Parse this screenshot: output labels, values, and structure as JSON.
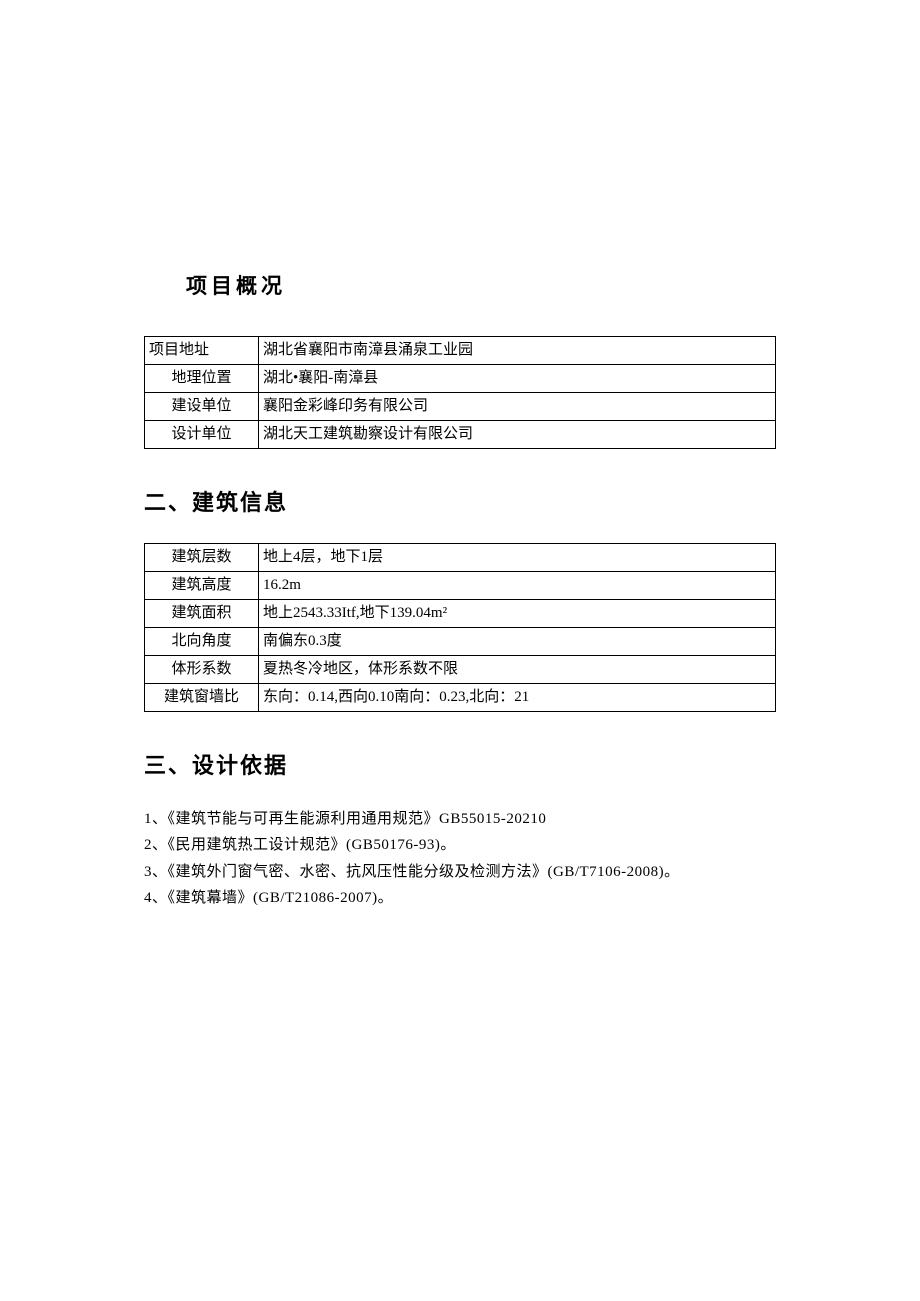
{
  "section1": {
    "title": "项目概况",
    "rows": [
      {
        "label": "项目地址",
        "value": "湖北省襄阳市南漳县涌泉工业园",
        "leftAlign": true
      },
      {
        "label": "地理位置",
        "value": "湖北•襄阳-南漳县",
        "leftAlign": false
      },
      {
        "label": "建设单位",
        "value": "襄阳金彩峰印务有限公司",
        "leftAlign": false
      },
      {
        "label": "设计单位",
        "value": "湖北天工建筑勘察设计有限公司",
        "leftAlign": false
      }
    ]
  },
  "section2": {
    "title": "二、建筑信息",
    "rows": [
      {
        "label": "建筑层数",
        "value": "地上4层，地下1层"
      },
      {
        "label": "建筑高度",
        "value": "16.2m"
      },
      {
        "label": "建筑面积",
        "value": "地上2543.33Itf,地下139.04m²"
      },
      {
        "label": "北向角度",
        "value": "南偏东0.3度"
      },
      {
        "label": "体形系数",
        "value": "夏热冬冷地区，体形系数不限"
      },
      {
        "label": "建筑窗墙比",
        "value": "东向：0.14,西向0.10南向：0.23,北向：21"
      }
    ]
  },
  "section3": {
    "title": "三、设计依据",
    "items": [
      "1、《建筑节能与可再生能源利用通用规范》GB55015-20210",
      "2、《民用建筑热工设计规范》(GB50176-93)。",
      "3、《建筑外门窗气密、水密、抗风压性能分级及检测方法》(GB/T7106-2008)。",
      "4、《建筑幕墙》(GB/T21086-2007)。"
    ]
  }
}
